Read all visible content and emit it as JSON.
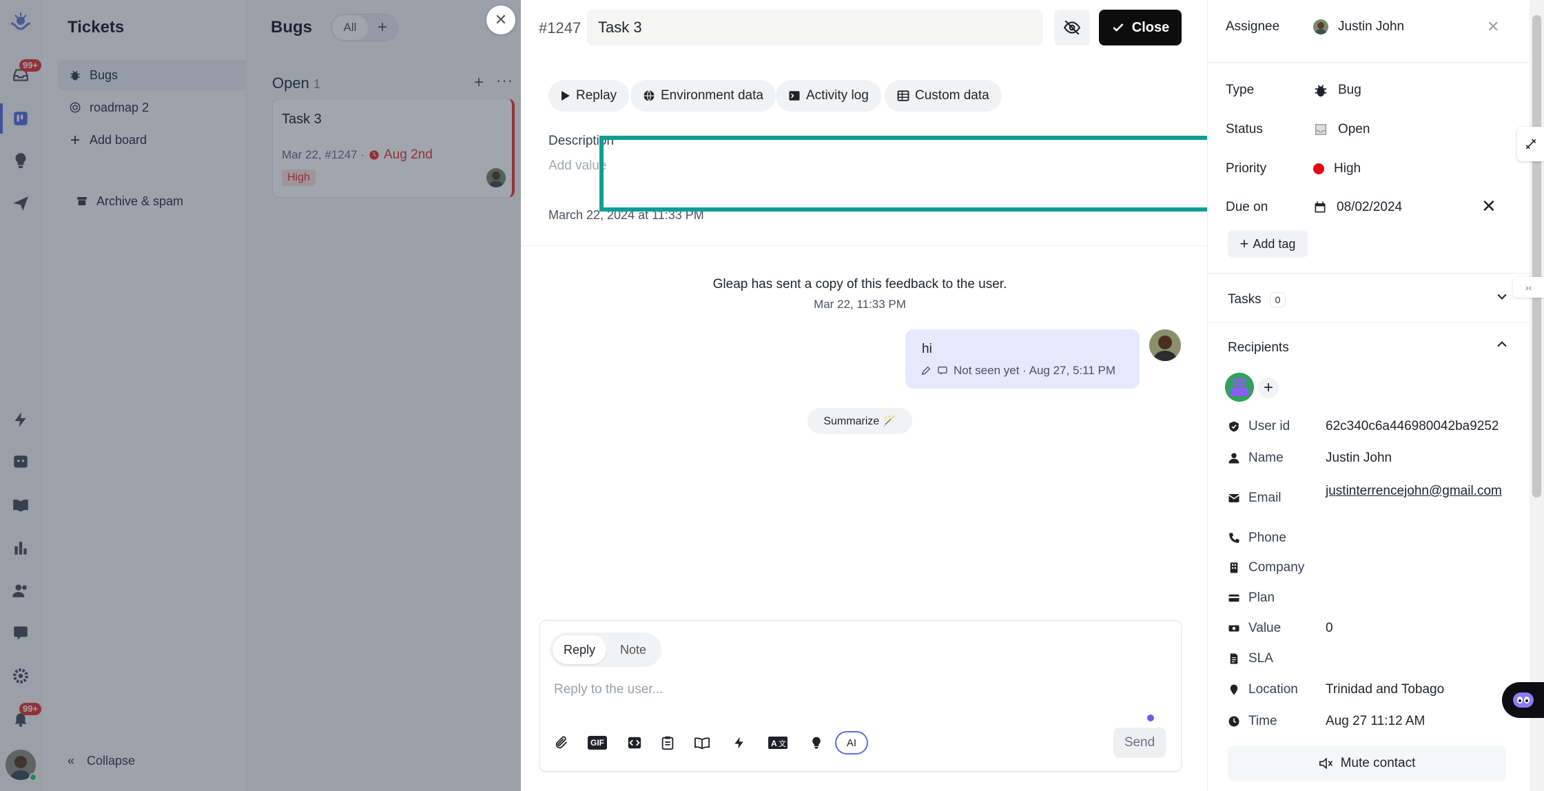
{
  "sidebar": {
    "title": "Tickets",
    "items": [
      {
        "label": "Bugs",
        "icon": "bug-icon"
      },
      {
        "label": "roadmap 2",
        "icon": "target-icon"
      },
      {
        "label": "Add board",
        "icon": "plus-icon"
      },
      {
        "label": "Archive & spam",
        "icon": "archive-icon"
      }
    ],
    "collapse_label": "Collapse"
  },
  "rail": {
    "inbox_badge": "99+",
    "notifications_badge": "99+"
  },
  "board": {
    "title": "Bugs",
    "filter_label": "All",
    "column": {
      "name": "Open",
      "count": "1"
    },
    "card": {
      "title": "Task 3",
      "meta": "Mar 22, #1247 ·",
      "due": "Aug 2nd",
      "priority": "High"
    }
  },
  "ticket": {
    "number": "#1247",
    "title": "Task 3",
    "close_label": "Close",
    "tabs": [
      "Replay",
      "Environment data",
      "Activity log",
      "Custom data"
    ],
    "description_label": "Description",
    "description_placeholder": "Add value",
    "created_at": "March 22, 2024 at 11:33 PM",
    "system_message": "Gleap has sent a copy of this feedback to the user.",
    "system_time": "Mar 22, 11:33 PM",
    "message": {
      "text": "hi",
      "meta": "Not seen yet · Aug 27, 5:11 PM"
    },
    "summarize_label": "Summarize 🪄",
    "composer": {
      "reply_tab": "Reply",
      "note_tab": "Note",
      "placeholder": "Reply to the user...",
      "ai_label": "AI",
      "send_label": "Send",
      "gif_label": "GIF"
    }
  },
  "details": {
    "assignee_label": "Assignee",
    "assignee_value": "Justin John",
    "type_label": "Type",
    "type_value": "Bug",
    "status_label": "Status",
    "status_value": "Open",
    "priority_label": "Priority",
    "priority_value": "High",
    "due_label": "Due on",
    "due_value": "08/02/2024",
    "add_tag_label": "Add tag",
    "tasks_label": "Tasks",
    "tasks_count": "0",
    "recipients_label": "Recipients",
    "user_fields": [
      {
        "label": "User id",
        "value": "62c340c6a446980042ba9252",
        "icon": "shield-icon"
      },
      {
        "label": "Name",
        "value": "Justin John",
        "icon": "person-icon"
      },
      {
        "label": "Email",
        "value": "justinterrencejohn@gmail.com",
        "icon": "mail-icon"
      },
      {
        "label": "Phone",
        "value": "",
        "icon": "phone-icon"
      },
      {
        "label": "Company",
        "value": "",
        "icon": "building-icon"
      },
      {
        "label": "Plan",
        "value": "",
        "icon": "card-icon"
      },
      {
        "label": "Value",
        "value": "0",
        "icon": "money-icon"
      },
      {
        "label": "SLA",
        "value": "",
        "icon": "file-icon"
      },
      {
        "label": "Location",
        "value": "Trinidad and Tobago",
        "icon": "pin-icon"
      },
      {
        "label": "Time",
        "value": "Aug 27 11:12 AM",
        "icon": "clock-icon"
      }
    ],
    "mute_label": "Mute contact"
  },
  "colors": {
    "accent": "#5b6ee1",
    "danger": "#e53935",
    "highlight": "#0f9d94"
  }
}
